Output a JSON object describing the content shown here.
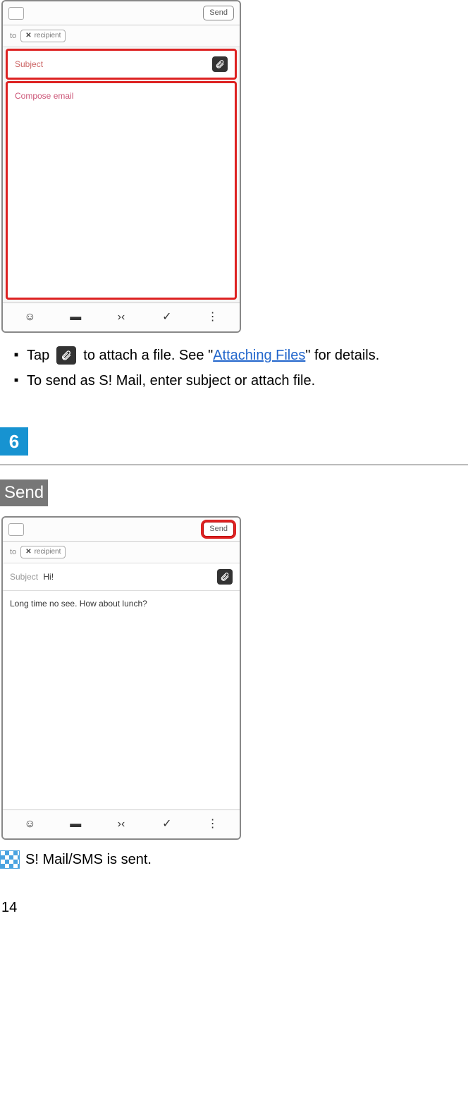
{
  "screenshot1": {
    "sendButton": "Send",
    "toLabel": "to",
    "contactName": "recipient",
    "subjectPlaceholder": "Subject",
    "bodyPlaceholder": "Compose email"
  },
  "bulletList": {
    "item1_pre": "Tap",
    "item1_post_a": "to attach a file. See \"",
    "item1_link": "Attaching Files",
    "item1_post_b": "\" for details.",
    "item2": "To send as S! Mail, enter subject or attach file."
  },
  "step": {
    "number": "6",
    "action": "Send"
  },
  "screenshot2": {
    "sendButton": "Send",
    "toLabel": "to",
    "contactName": "recipient",
    "subjectLabel": "Subject",
    "subjectValue": "Hi!",
    "bodyText": "Long time no see. How about lunch?"
  },
  "result": "S! Mail/SMS is sent.",
  "pageNumber": "14"
}
